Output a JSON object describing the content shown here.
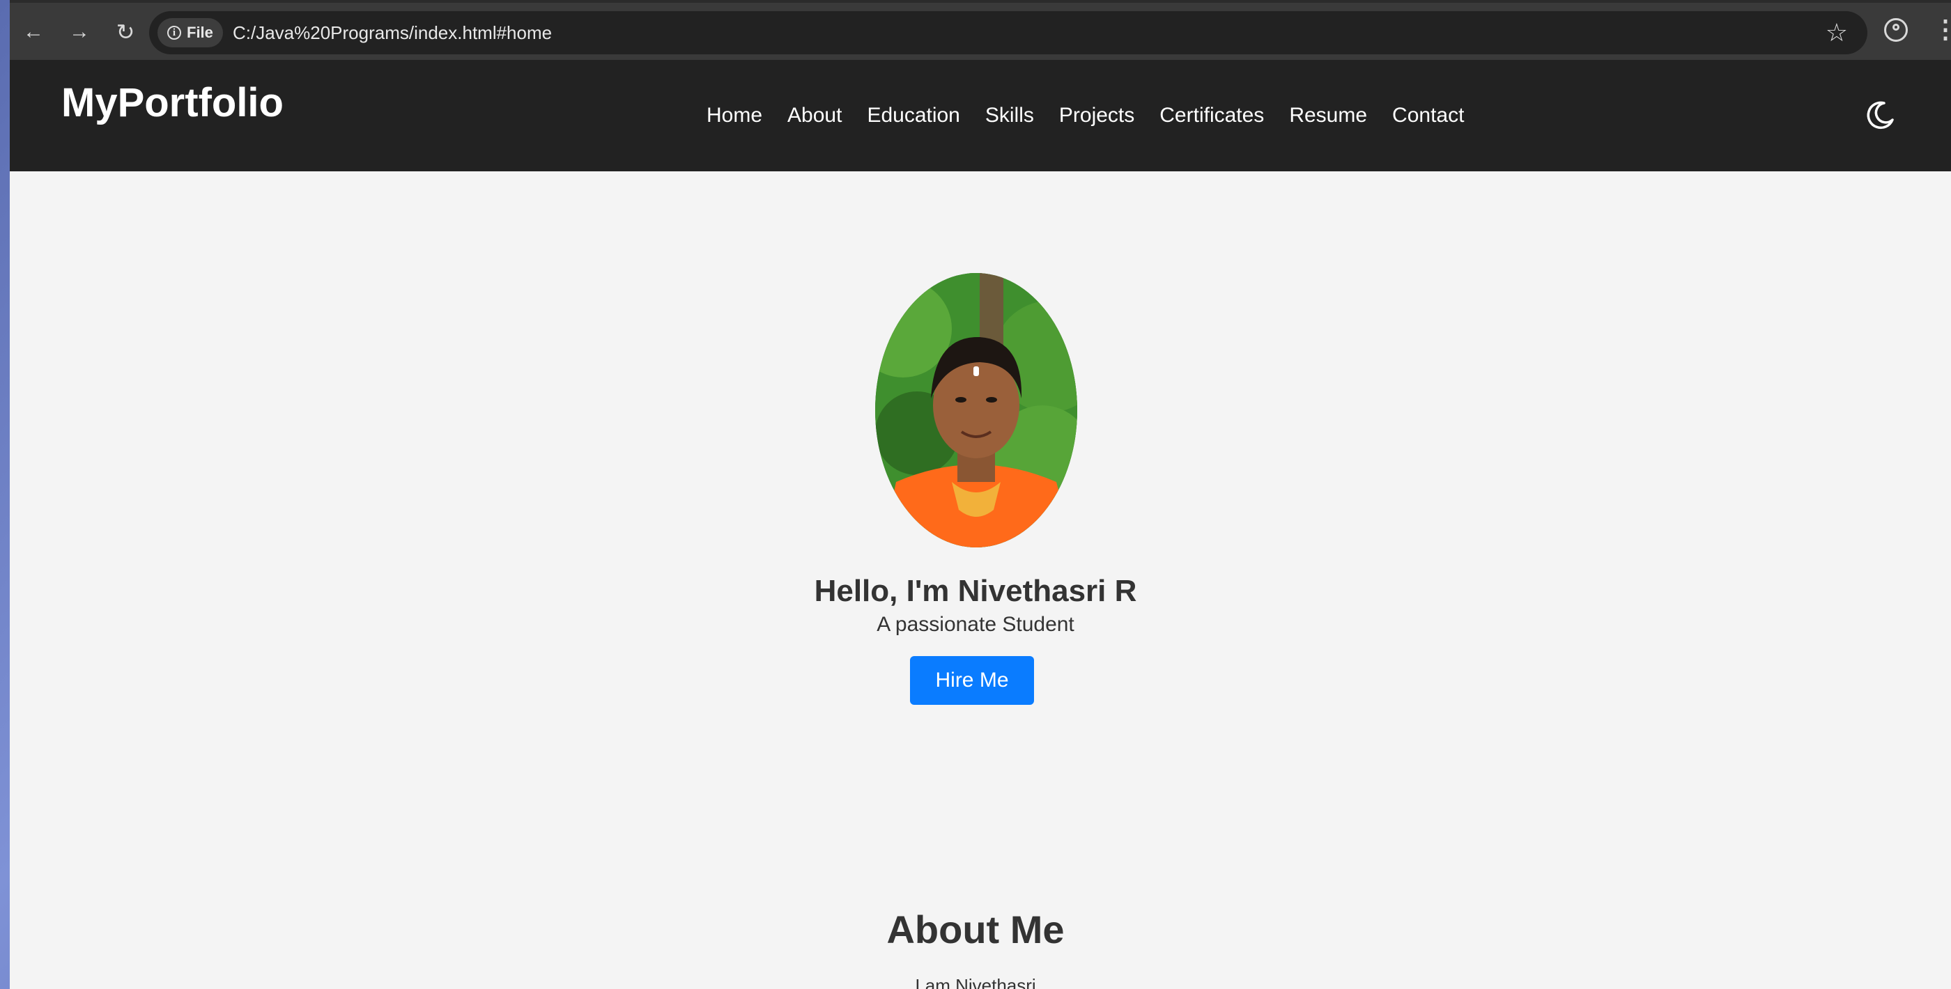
{
  "browser": {
    "file_chip": "File",
    "url": "C:/Java%20Programs/index.html#home",
    "icons": [
      "back-icon",
      "forward-icon",
      "reload-icon",
      "info-icon",
      "bookmark-star-icon",
      "profile-icon",
      "more-menu-icon"
    ]
  },
  "site": {
    "logo": "MyPortfolio",
    "nav": [
      "Home",
      "About",
      "Education",
      "Skills",
      "Projects",
      "Certificates",
      "Resume",
      "Contact"
    ],
    "theme_toggle_icon": "moon-icon"
  },
  "hero": {
    "title": "Hello, I'm Nivethasri R",
    "subtitle": "A passionate Student",
    "button": "Hire Me"
  },
  "about": {
    "title": "About Me",
    "text": "I am Nivethasri"
  },
  "colors": {
    "navbar": "#222222",
    "page_bg": "#f4f4f4",
    "accent_button": "#0a7cff"
  }
}
